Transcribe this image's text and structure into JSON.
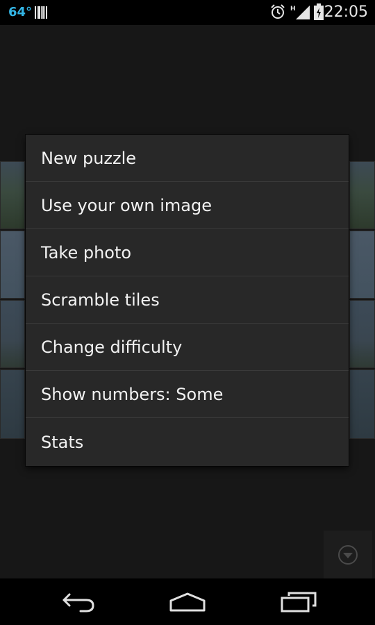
{
  "status_bar": {
    "temperature": "64°",
    "time": "22:05",
    "network_type": "H",
    "icons": [
      "barcode-icon",
      "alarm-icon",
      "signal-icon",
      "battery-icon"
    ]
  },
  "menu": {
    "items": [
      {
        "label": "New puzzle"
      },
      {
        "label": "Use your own image"
      },
      {
        "label": "Take photo"
      },
      {
        "label": "Scramble tiles"
      },
      {
        "label": "Change difficulty"
      },
      {
        "label": "Show numbers: Some"
      },
      {
        "label": "Stats"
      }
    ]
  },
  "navigation": {
    "icons": [
      "back-icon",
      "home-icon",
      "recent-apps-icon"
    ]
  },
  "colors": {
    "accent": "#33b5e5",
    "menu_background": "#282828",
    "app_background": "#171717"
  }
}
